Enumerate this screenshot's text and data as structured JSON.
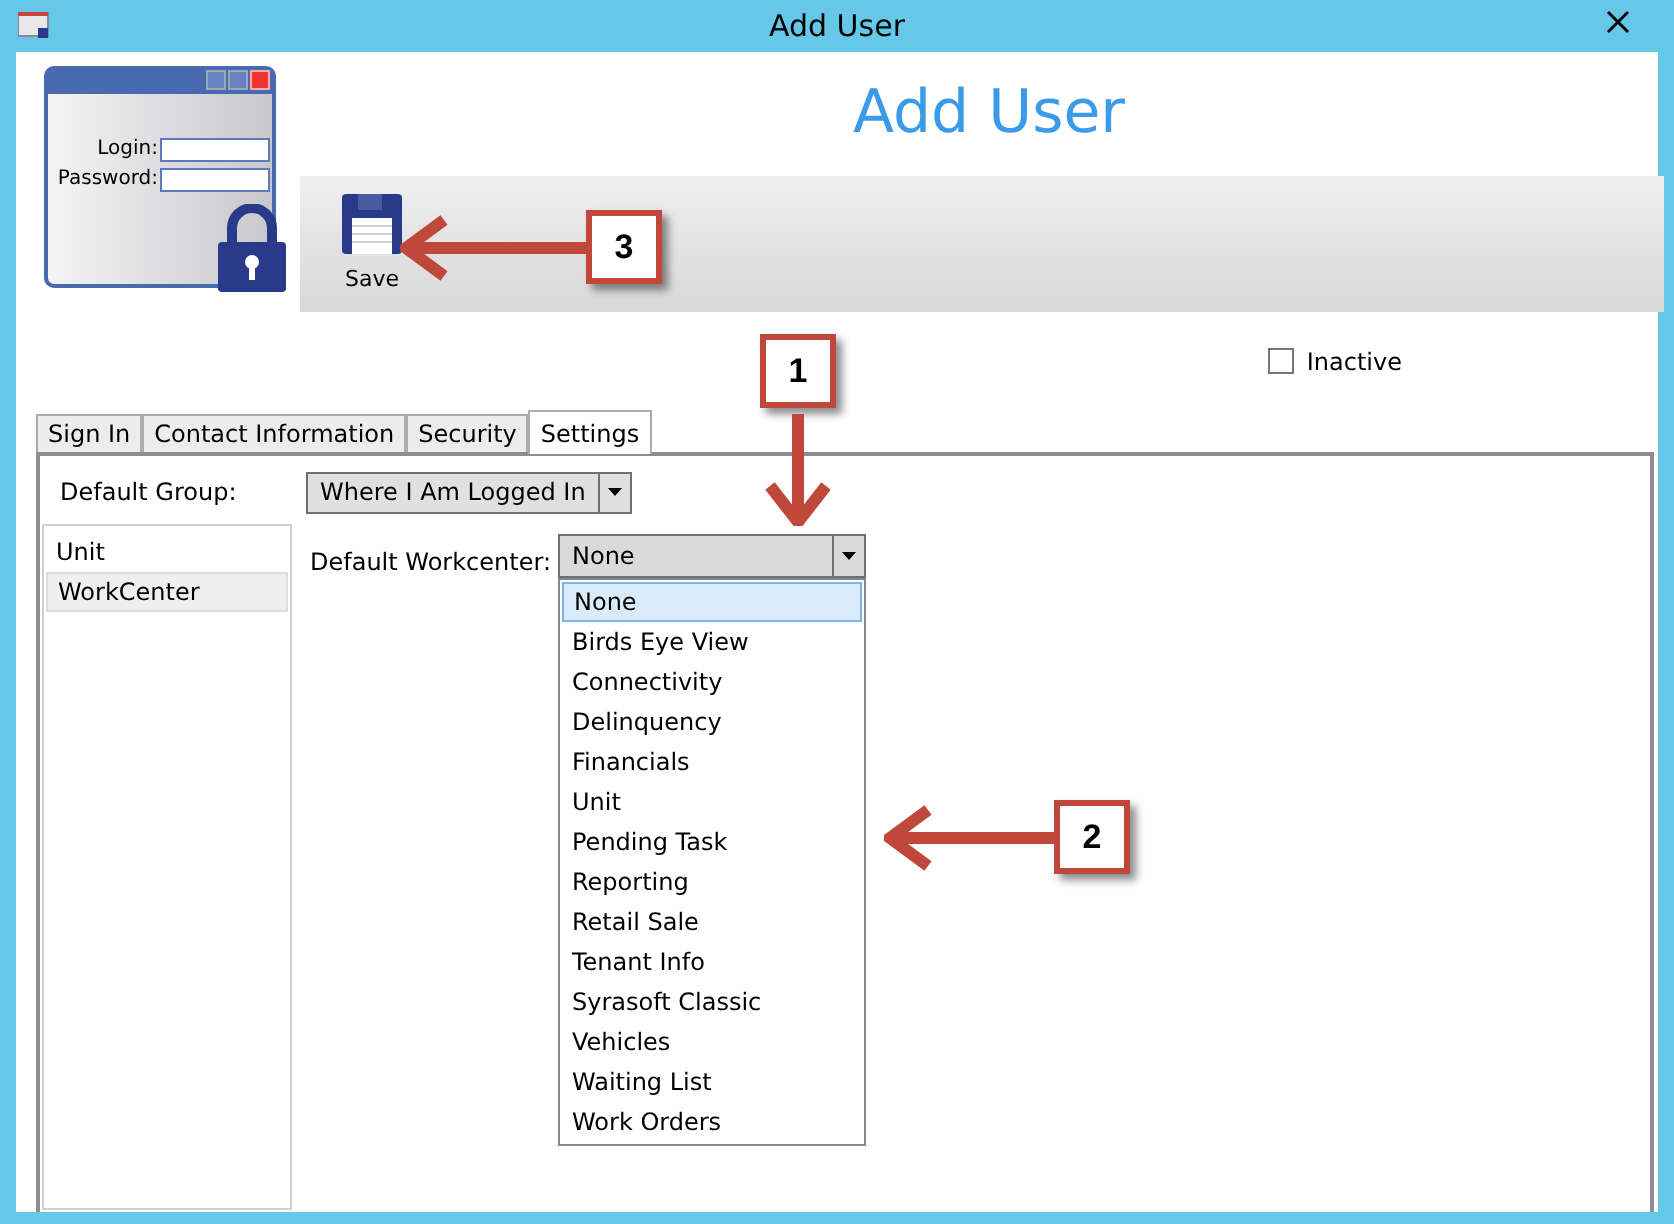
{
  "window": {
    "title": "Add User"
  },
  "header": {
    "title": "Add User",
    "logo": {
      "login_label": "Login:",
      "password_label": "Password:"
    }
  },
  "toolbar": {
    "buttons": [
      {
        "label": "Save"
      }
    ]
  },
  "inactive": {
    "label": "Inactive",
    "checked": false
  },
  "tabs": [
    {
      "label": "Sign In",
      "selected": false
    },
    {
      "label": "Contact Information",
      "selected": false
    },
    {
      "label": "Security",
      "selected": false
    },
    {
      "label": "Settings",
      "selected": true
    }
  ],
  "settings": {
    "default_group": {
      "label": "Default Group:",
      "value": "Where I Am Logged In"
    },
    "side_list": [
      {
        "label": "Unit",
        "selected": false
      },
      {
        "label": "WorkCenter",
        "selected": true
      }
    ],
    "default_workcenter": {
      "label": "Default Workcenter:",
      "value": "None",
      "expanded": true,
      "options": [
        {
          "label": "None",
          "selected": true
        },
        {
          "label": "Birds Eye View",
          "selected": false
        },
        {
          "label": "Connectivity",
          "selected": false
        },
        {
          "label": "Delinquency",
          "selected": false
        },
        {
          "label": "Financials",
          "selected": false
        },
        {
          "label": "Unit",
          "selected": false
        },
        {
          "label": "Pending Task",
          "selected": false
        },
        {
          "label": "Reporting",
          "selected": false
        },
        {
          "label": "Retail Sale",
          "selected": false
        },
        {
          "label": "Tenant Info",
          "selected": false
        },
        {
          "label": "Syrasoft Classic",
          "selected": false
        },
        {
          "label": "Vehicles",
          "selected": false
        },
        {
          "label": "Waiting List",
          "selected": false
        },
        {
          "label": "Work Orders",
          "selected": false
        }
      ]
    }
  },
  "callouts": [
    {
      "number": "1"
    },
    {
      "number": "2"
    },
    {
      "number": "3"
    }
  ]
}
